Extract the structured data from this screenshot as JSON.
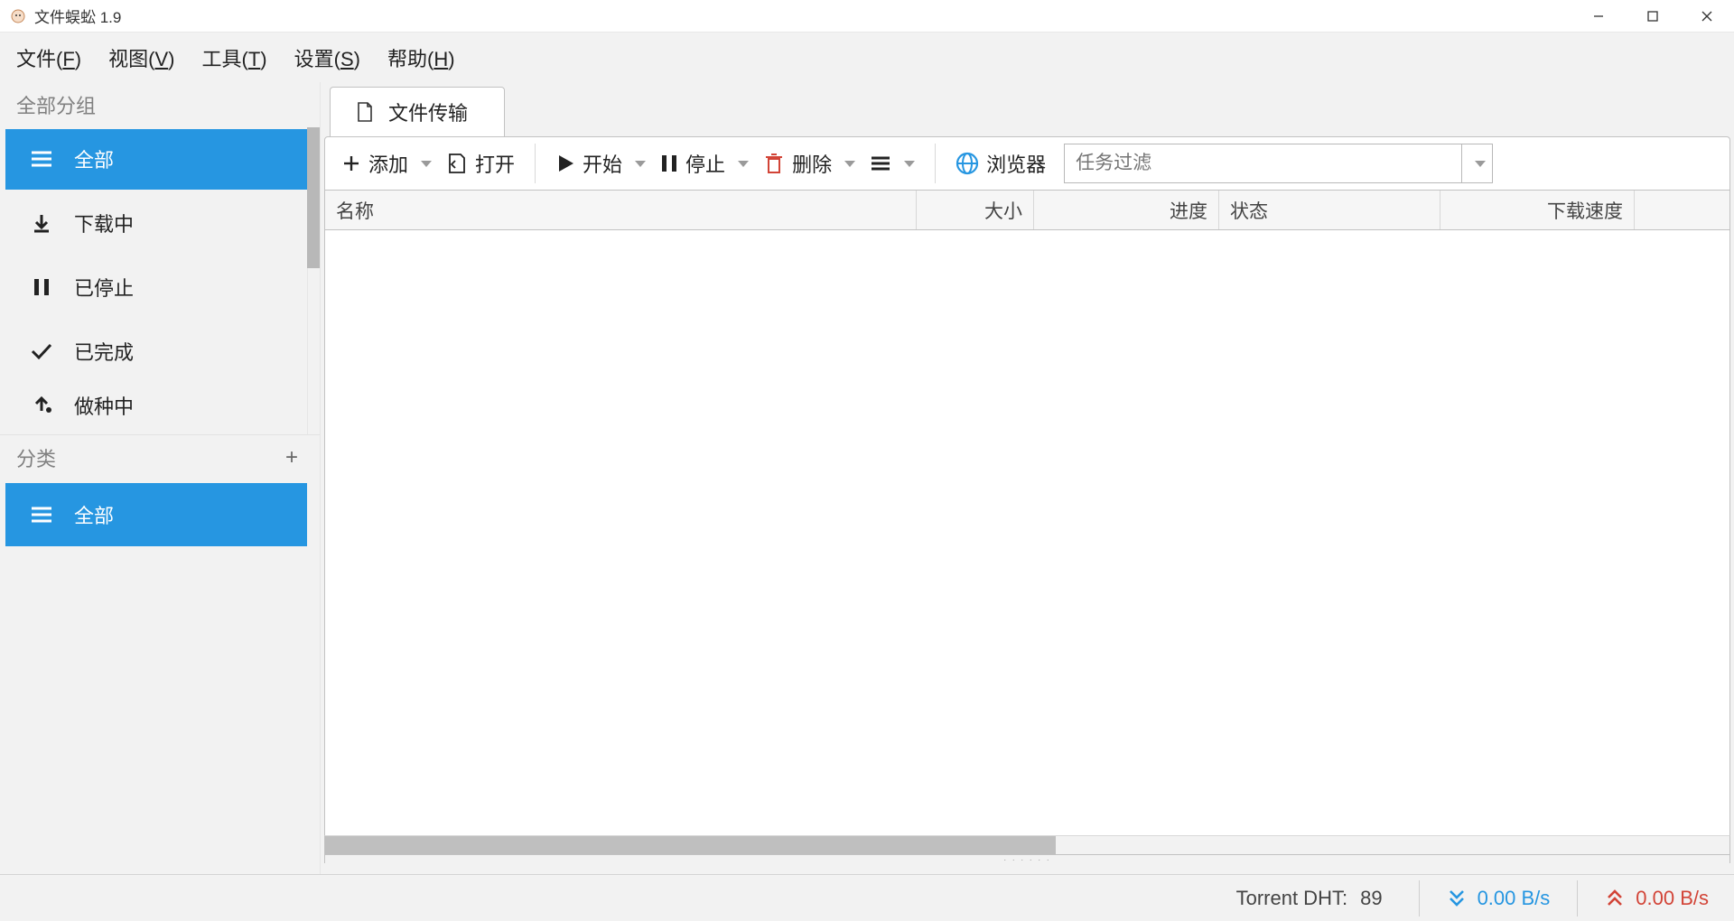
{
  "window": {
    "title": "文件蜈蚣 1.9"
  },
  "menu": {
    "file": {
      "label": "文件",
      "hotkey": "F"
    },
    "view": {
      "label": "视图",
      "hotkey": "V"
    },
    "tools": {
      "label": "工具",
      "hotkey": "T"
    },
    "settings": {
      "label": "设置",
      "hotkey": "S"
    },
    "help": {
      "label": "帮助",
      "hotkey": "H"
    }
  },
  "sidebar": {
    "group_header": "全部分组",
    "items": [
      {
        "label": "全部",
        "icon": "menu"
      },
      {
        "label": "下载中",
        "icon": "download"
      },
      {
        "label": "已停止",
        "icon": "pause"
      },
      {
        "label": "已完成",
        "icon": "check"
      },
      {
        "label": "做种中",
        "icon": "upload"
      }
    ],
    "category_header": "分类",
    "categories": [
      {
        "label": "全部",
        "icon": "menu"
      }
    ]
  },
  "tab": {
    "label": "文件传输"
  },
  "toolbar": {
    "add": "添加",
    "open": "打开",
    "start": "开始",
    "stop": "停止",
    "delete": "删除",
    "browser": "浏览器",
    "filter_placeholder": "任务过滤"
  },
  "columns": {
    "name": "名称",
    "size": "大小",
    "progress": "进度",
    "status": "状态",
    "down_speed": "下载速度"
  },
  "status": {
    "dht_label": "Torrent DHT:",
    "dht_value": "89",
    "down_speed": "0.00 B/s",
    "up_speed": "0.00 B/s"
  },
  "colors": {
    "accent": "#2696e1",
    "danger": "#d24437"
  }
}
